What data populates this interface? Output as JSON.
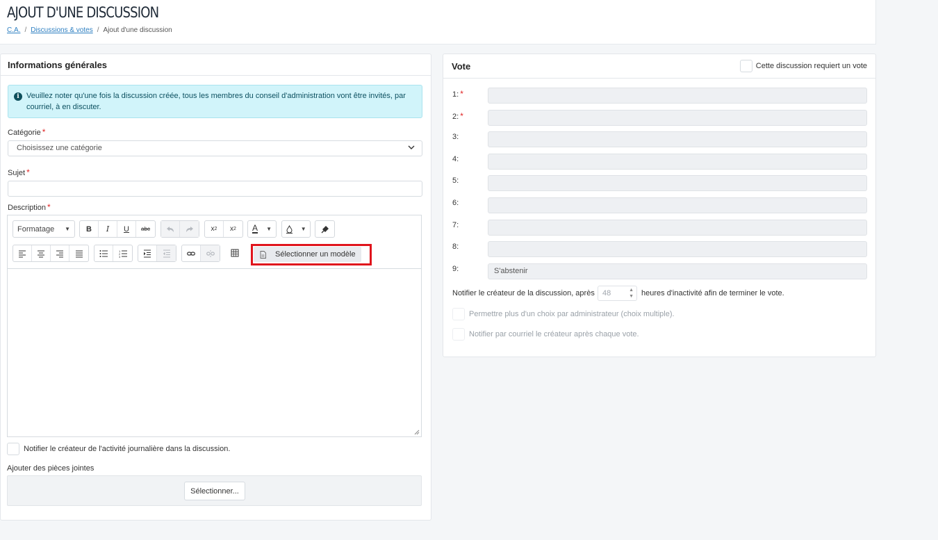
{
  "header": {
    "title": "AJOUT D'UNE DISCUSSION",
    "breadcrumb": [
      {
        "label": "C.A."
      },
      {
        "label": "Discussions & votes"
      },
      {
        "label": "Ajout d'une discussion"
      }
    ]
  },
  "general": {
    "heading": "Informations générales",
    "alert_text": "Veuillez noter qu'une fois la discussion créée, tous les membres du conseil d'administration vont être invités, par courriel, à en discuter.",
    "category_label": "Catégorie",
    "category_value": "Choisissez une catégorie",
    "subject_label": "Sujet",
    "subject_value": "",
    "description_label": "Description",
    "required_mark": "*",
    "editor": {
      "format_label": "Formatage",
      "bold": "B",
      "italic": "I",
      "underline": "U",
      "strike": "abc",
      "font_color_letter": "A",
      "select_template": "Sélectionner un modèle"
    },
    "notify_daily_label": "Notifier le créateur de l'activité journalière dans la discussion.",
    "attachments_label": "Ajouter des pièces jointes",
    "attach_button": "Sélectionner..."
  },
  "vote": {
    "heading": "Vote",
    "requires_vote_label": "Cette discussion requiert un vote",
    "options": [
      {
        "num": "1:",
        "required": true,
        "value": ""
      },
      {
        "num": "2:",
        "required": true,
        "value": ""
      },
      {
        "num": "3:",
        "required": false,
        "value": ""
      },
      {
        "num": "4:",
        "required": false,
        "value": ""
      },
      {
        "num": "5:",
        "required": false,
        "value": ""
      },
      {
        "num": "6:",
        "required": false,
        "value": ""
      },
      {
        "num": "7:",
        "required": false,
        "value": ""
      },
      {
        "num": "8:",
        "required": false,
        "value": ""
      },
      {
        "num": "9:",
        "required": false,
        "value": "S'abstenir"
      }
    ],
    "notify_before": "Notifier le créateur de la discussion, après",
    "hours_value": "48",
    "notify_after": "heures d'inactivité afin de terminer le vote.",
    "multiple_choice_label": "Permettre plus d'un choix par administrateur (choix multiple).",
    "notify_each_vote_label": "Notifier par courriel le créateur après chaque vote."
  },
  "colors": {
    "accent_link": "#2d7fc1",
    "required": "#e02424",
    "alert_bg": "#d1f4fa",
    "highlight": "#e0141c"
  }
}
